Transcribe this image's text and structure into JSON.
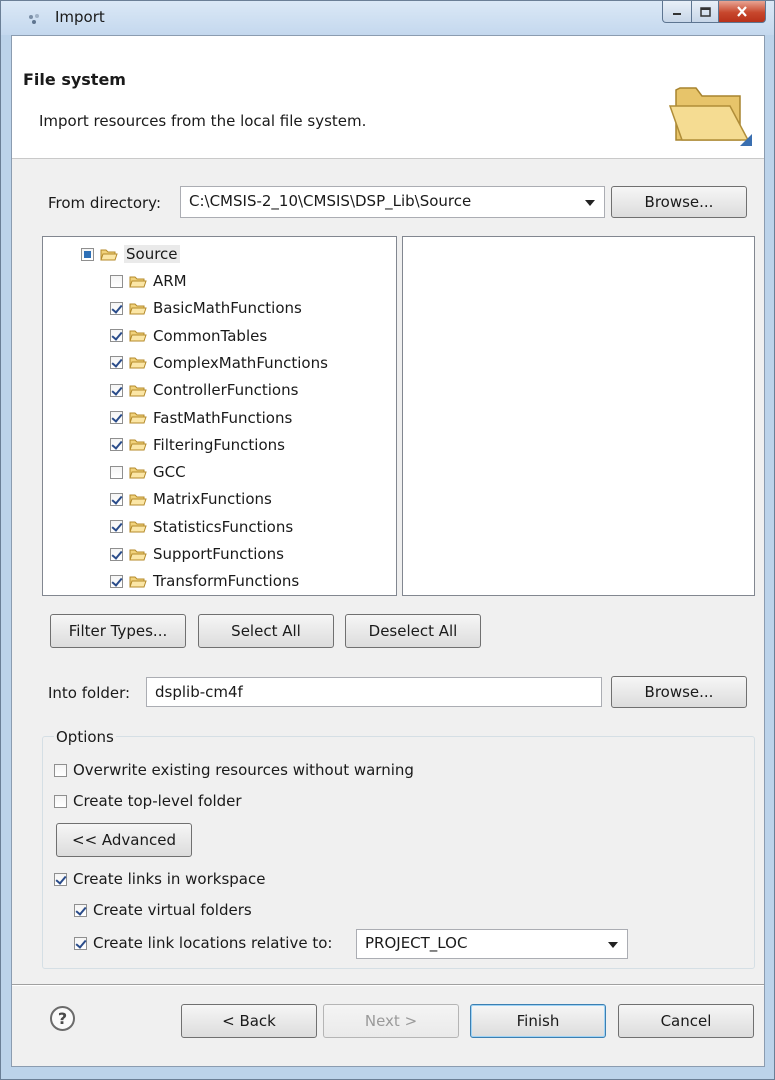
{
  "window": {
    "title": "Import"
  },
  "banner": {
    "title": "File system",
    "description": "Import resources from the local file system."
  },
  "from_directory": {
    "label": "From directory:",
    "value": "C:\\CMSIS-2_10\\CMSIS\\DSP_Lib\\Source",
    "browse_label": "Browse..."
  },
  "tree": {
    "root": {
      "label": "Source",
      "state": "mixed"
    },
    "items": [
      {
        "label": "ARM",
        "checked": false
      },
      {
        "label": "BasicMathFunctions",
        "checked": true
      },
      {
        "label": "CommonTables",
        "checked": true
      },
      {
        "label": "ComplexMathFunctions",
        "checked": true
      },
      {
        "label": "ControllerFunctions",
        "checked": true
      },
      {
        "label": "FastMathFunctions",
        "checked": true
      },
      {
        "label": "FilteringFunctions",
        "checked": true
      },
      {
        "label": "GCC",
        "checked": false
      },
      {
        "label": "MatrixFunctions",
        "checked": true
      },
      {
        "label": "StatisticsFunctions",
        "checked": true
      },
      {
        "label": "SupportFunctions",
        "checked": true
      },
      {
        "label": "TransformFunctions",
        "checked": true
      }
    ]
  },
  "selection_buttons": {
    "filter_types": "Filter Types...",
    "select_all": "Select All",
    "deselect_all": "Deselect All"
  },
  "into_folder": {
    "label": "Into folder:",
    "value": "dsplib-cm4f",
    "browse_label": "Browse..."
  },
  "options": {
    "title": "Options",
    "overwrite": {
      "label": "Overwrite existing resources without warning",
      "checked": false
    },
    "top_level": {
      "label": "Create top-level folder",
      "checked": false
    },
    "advanced_label": "<< Advanced",
    "create_links": {
      "label": "Create links in workspace",
      "checked": true
    },
    "virtual_folders": {
      "label": "Create virtual folders",
      "checked": true
    },
    "relative_links": {
      "label": "Create link locations relative to:",
      "checked": true,
      "value": "PROJECT_LOC"
    }
  },
  "footer": {
    "help": "?",
    "back": "< Back",
    "next": "Next >",
    "finish": "Finish",
    "cancel": "Cancel"
  }
}
